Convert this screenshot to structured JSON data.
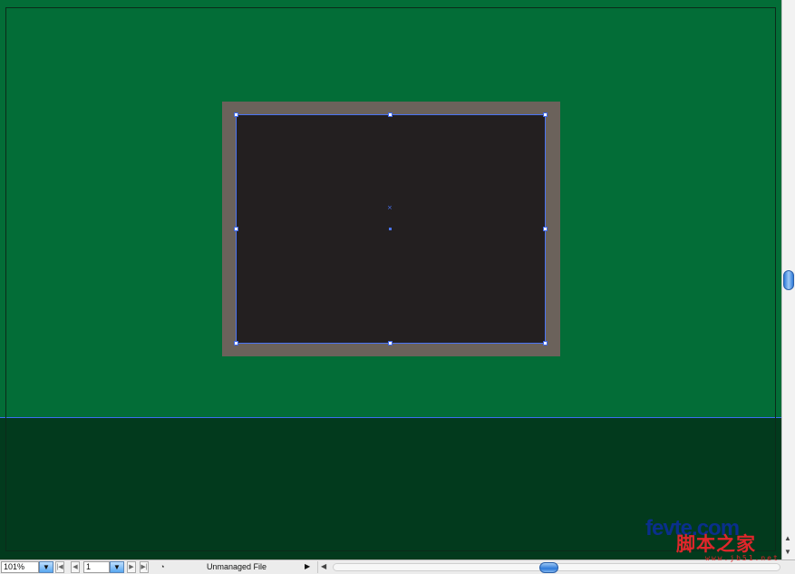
{
  "document": {
    "canvas_color": "#036d37",
    "lower_band_color": "#023a1d",
    "frame_color": "#6b625b",
    "inner_rect_color": "#231f20",
    "selection_color": "#4a74f5"
  },
  "status_bar": {
    "zoom_value": "101%",
    "page_value": "1",
    "status_text": "Unmanaged File",
    "nav_icons": [
      "first-page-icon",
      "prev-page-icon",
      "next-page-icon",
      "last-page-icon"
    ]
  },
  "scrollbars": {
    "vertical_position": 0.5,
    "horizontal_position": 0.5
  },
  "watermark": {
    "main": "fevte.com",
    "chinese": "脚本之家",
    "url": "www.jb51.net"
  }
}
